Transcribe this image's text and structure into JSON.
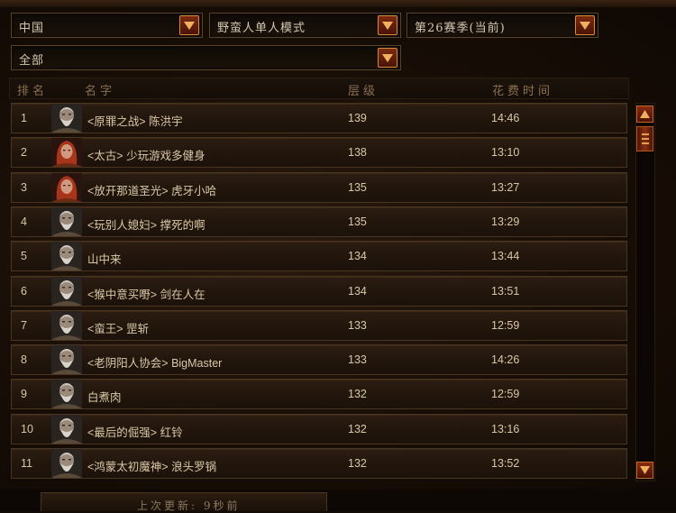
{
  "filters": {
    "region": "中国",
    "mode": "野蛮人单人模式",
    "season": "第26赛季(当前)",
    "clan": "全部"
  },
  "table": {
    "headers": {
      "rank": "排名",
      "name": "名字",
      "tier": "层级",
      "time": "花费时间"
    },
    "rows": [
      {
        "rank": "1",
        "name": "<原罪之战> 陈洪宇",
        "tier": "139",
        "time": "14:46",
        "portrait": "male"
      },
      {
        "rank": "2",
        "name": "<太古> 少玩游戏多健身",
        "tier": "138",
        "time": "13:10",
        "portrait": "female"
      },
      {
        "rank": "3",
        "name": "<放开那道圣光> 虎牙小哈",
        "tier": "135",
        "time": "13:27",
        "portrait": "female"
      },
      {
        "rank": "4",
        "name": "<玩别人媳妇> 撑死的啊",
        "tier": "135",
        "time": "13:29",
        "portrait": "male"
      },
      {
        "rank": "5",
        "name": "山中来",
        "tier": "134",
        "time": "13:44",
        "portrait": "male"
      },
      {
        "rank": "6",
        "name": "<猴中意买嘢> 剑在人在",
        "tier": "134",
        "time": "13:51",
        "portrait": "male"
      },
      {
        "rank": "7",
        "name": "<蛮王> 罡斩",
        "tier": "133",
        "time": "12:59",
        "portrait": "male"
      },
      {
        "rank": "8",
        "name": "<老阴阳人协会> BigMaster",
        "tier": "133",
        "time": "14:26",
        "portrait": "male"
      },
      {
        "rank": "9",
        "name": "白煮肉",
        "tier": "132",
        "time": "12:59",
        "portrait": "male"
      },
      {
        "rank": "10",
        "name": "<最后的倔强> 红铃",
        "tier": "132",
        "time": "13:16",
        "portrait": "male"
      },
      {
        "rank": "11",
        "name": "<鸿蒙太初魔神> 浪头罗锅",
        "tier": "132",
        "time": "13:52",
        "portrait": "male"
      }
    ]
  },
  "footer": {
    "last_update": "上次更新: 9秒前"
  },
  "colors": {
    "accent": "#c06a2a",
    "text": "#d8c8a8",
    "header": "#8a7050"
  },
  "icons": {
    "dropdown": "chevron-down-icon",
    "scroll_up": "arrow-up-icon",
    "scroll_down": "arrow-down-icon"
  }
}
